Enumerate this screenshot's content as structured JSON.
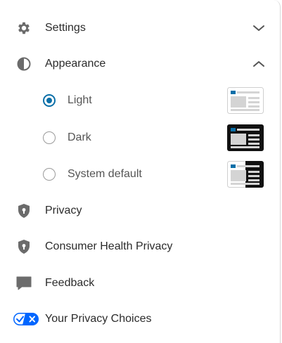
{
  "menu": {
    "settings": {
      "label": "Settings",
      "icon": "gear-icon",
      "expanded": false
    },
    "appearance": {
      "label": "Appearance",
      "icon": "contrast-icon",
      "expanded": true,
      "options": [
        {
          "label": "Light",
          "selected": true,
          "thumbnail": "light-theme-preview"
        },
        {
          "label": "Dark",
          "selected": false,
          "thumbnail": "dark-theme-preview"
        },
        {
          "label": "System default",
          "selected": false,
          "thumbnail": "system-theme-preview"
        }
      ]
    },
    "privacy": {
      "label": "Privacy",
      "icon": "shield-lock-icon"
    },
    "consumer_health_privacy": {
      "label": "Consumer Health Privacy",
      "icon": "shield-lock-icon"
    },
    "feedback": {
      "label": "Feedback",
      "icon": "chat-bubble-icon"
    },
    "privacy_choices": {
      "label": "Your Privacy Choices",
      "icon": "privacy-choices-toggle-icon"
    }
  },
  "colors": {
    "icon_gray": "#6b6b6b",
    "accent_blue": "#0a6fa8",
    "privacy_blue": "#0066ff",
    "text": "#2b2b2b",
    "subtext": "#555555"
  }
}
